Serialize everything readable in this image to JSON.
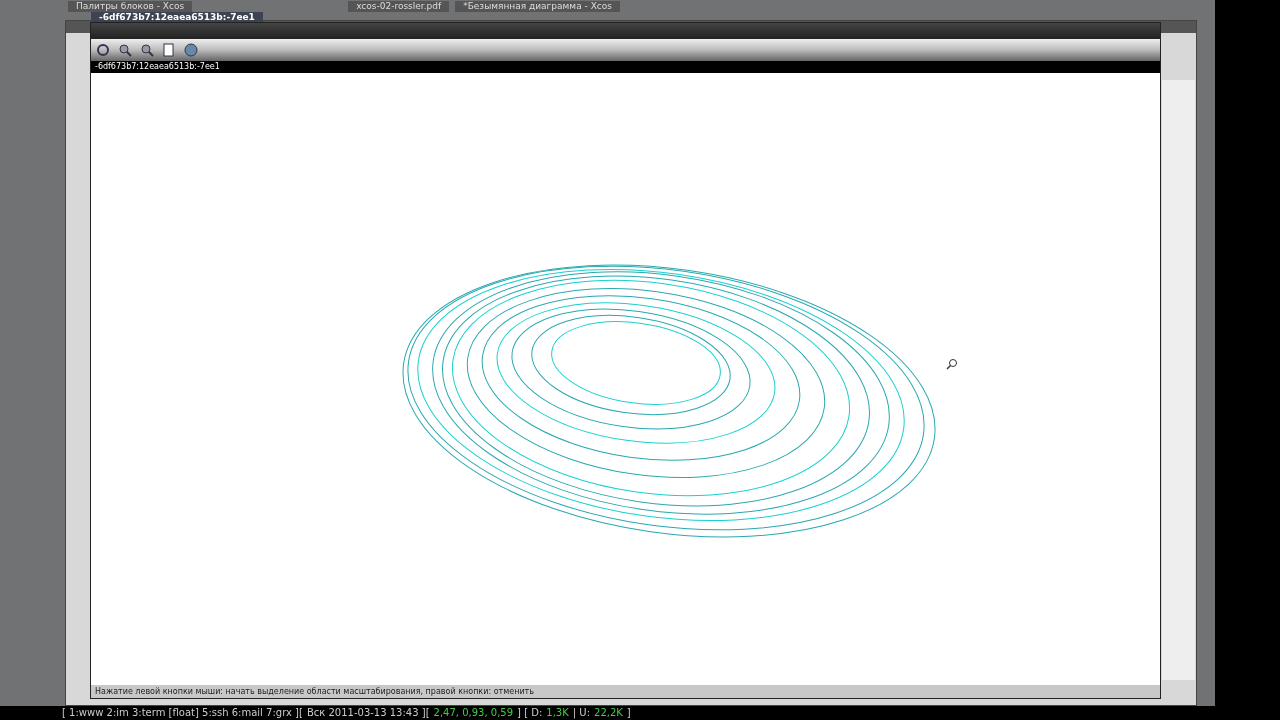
{
  "taskbar_tabs": [
    {
      "label": "Палитры блоков - Xcos",
      "selected": false
    },
    {
      "label": "xcos-02-rossler.pdf",
      "selected": false
    },
    {
      "label": "*Безымянная диаграмма - Xcos",
      "selected": false
    }
  ],
  "window": {
    "title": "-6df673b7:12eaea6513b:-7ee1",
    "header": "-6df673b7:12eaea6513b:-7ee1"
  },
  "status_bar": "Нажатие левой кнопки мыши: начать выделение области масштабирования, правой кнопки: отменить",
  "system_bar": {
    "workspaces": "[  1:www 2:im 3:term [float] 5:ssh 6:mail 7:grx ][",
    "clock": "Вск 2011-03-13 13:43 ][",
    "load": "2,47, 0,93, 0,59",
    "net_down_label": "] [ D:",
    "net_down": "1,3K",
    "net_up_label": "| U:",
    "net_up": "22,2K",
    "end": "]"
  }
}
